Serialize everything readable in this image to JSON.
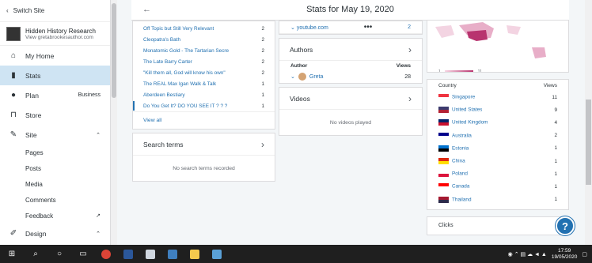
{
  "sidebar": {
    "switch_label": "Switch Site",
    "site_name": "Hidden History Research",
    "site_url": "View gretabrookesauthor.com",
    "items": [
      {
        "label": "My Home",
        "icon": "home-icon"
      },
      {
        "label": "Stats",
        "icon": "stats-icon"
      },
      {
        "label": "Plan",
        "icon": "plan-icon",
        "badge": "Business"
      },
      {
        "label": "Store",
        "icon": "cart-icon"
      },
      {
        "label": "Site",
        "icon": "brush-icon"
      }
    ],
    "sub_items": [
      "Pages",
      "Posts",
      "Media",
      "Comments",
      "Feedback"
    ],
    "design": "Design"
  },
  "header": {
    "title": "Stats for May 19, 2020",
    "back": "←"
  },
  "posts": {
    "rows": [
      {
        "title": "Off Topic but Still Very Relevant",
        "views": "2"
      },
      {
        "title": "Cleopatra's Bath",
        "views": "2"
      },
      {
        "title": "Monatomic Gold - The Tartarian Secre",
        "views": "2"
      },
      {
        "title": "The Late Barry Carter",
        "views": "2"
      },
      {
        "title": "\"Kill them all, God will know his own\"",
        "views": "2"
      },
      {
        "title": "The REAL Max Igan Walk & Talk",
        "views": "1"
      },
      {
        "title": "Aberdeen Bestiary",
        "views": "1"
      },
      {
        "title": "Do You Get It? DO YOU SEE IT ? ? ?",
        "views": "1"
      }
    ],
    "view_all": "View all"
  },
  "search_terms": {
    "title": "Search terms",
    "empty": "No search terms recorded"
  },
  "referrer": {
    "label": "youtube.com",
    "views": "2",
    "more": "•••"
  },
  "authors": {
    "title": "Authors",
    "col_author": "Author",
    "col_views": "Views",
    "name": "Greta",
    "views": "28"
  },
  "videos": {
    "title": "Videos",
    "empty": "No videos played"
  },
  "map": {
    "legend_min": "1",
    "legend_max": "11"
  },
  "countries": {
    "col_country": "Country",
    "col_views": "Views",
    "rows": [
      {
        "name": "Singapore",
        "views": "11",
        "flag": [
          "#ef3340",
          "#ffffff"
        ]
      },
      {
        "name": "United States",
        "views": "9",
        "flag": [
          "#3c3b6e",
          "#b22234"
        ]
      },
      {
        "name": "United Kingdom",
        "views": "4",
        "flag": [
          "#012169",
          "#c8102e"
        ]
      },
      {
        "name": "Australia",
        "views": "2",
        "flag": [
          "#00008b",
          "#ffffff"
        ]
      },
      {
        "name": "Estonia",
        "views": "1",
        "flag": [
          "#0072ce",
          "#000000"
        ]
      },
      {
        "name": "China",
        "views": "1",
        "flag": [
          "#de2910",
          "#ffde00"
        ]
      },
      {
        "name": "Poland",
        "views": "1",
        "flag": [
          "#ffffff",
          "#dc143c"
        ]
      },
      {
        "name": "Canada",
        "views": "1",
        "flag": [
          "#ff0000",
          "#ffffff"
        ]
      },
      {
        "name": "Thailand",
        "views": "1",
        "flag": [
          "#a51931",
          "#2d2a4a"
        ]
      }
    ]
  },
  "clicks": {
    "title": "Clicks"
  },
  "help": {
    "label": "?"
  },
  "taskbar": {
    "time": "17:59",
    "date": "19/05/2020"
  }
}
